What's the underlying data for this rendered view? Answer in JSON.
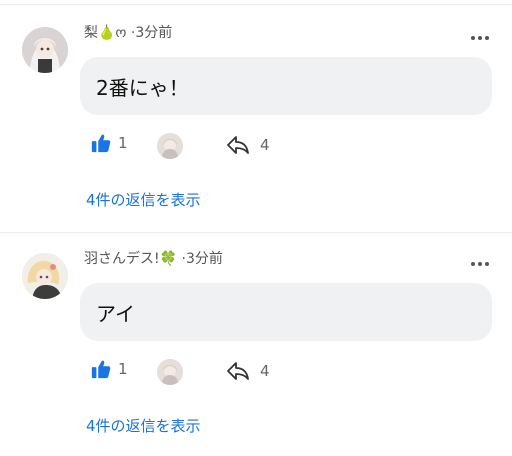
{
  "comments": [
    {
      "author": "梨🍐ო",
      "separator": "·",
      "time": "3分前",
      "text": "2番にゃ！",
      "likes": "1",
      "shares": "4",
      "replies_link": "4件の返信を表示",
      "more_icon": "more-horizontal-icon",
      "like_icon": "thumbs-up-icon",
      "share_icon": "reply-arrow-icon"
    },
    {
      "author": "羽さんデス!🍀",
      "separator": "·",
      "time": "3分前",
      "text": "アイ",
      "likes": "1",
      "shares": "4",
      "replies_link": "4件の返信を表示",
      "more_icon": "more-horizontal-icon",
      "like_icon": "thumbs-up-icon",
      "share_icon": "reply-arrow-icon"
    }
  ],
  "colors": {
    "link": "#1a73d8",
    "like": "#1b74e4",
    "bubble": "#f0f1f2",
    "divider": "#ebebeb"
  }
}
